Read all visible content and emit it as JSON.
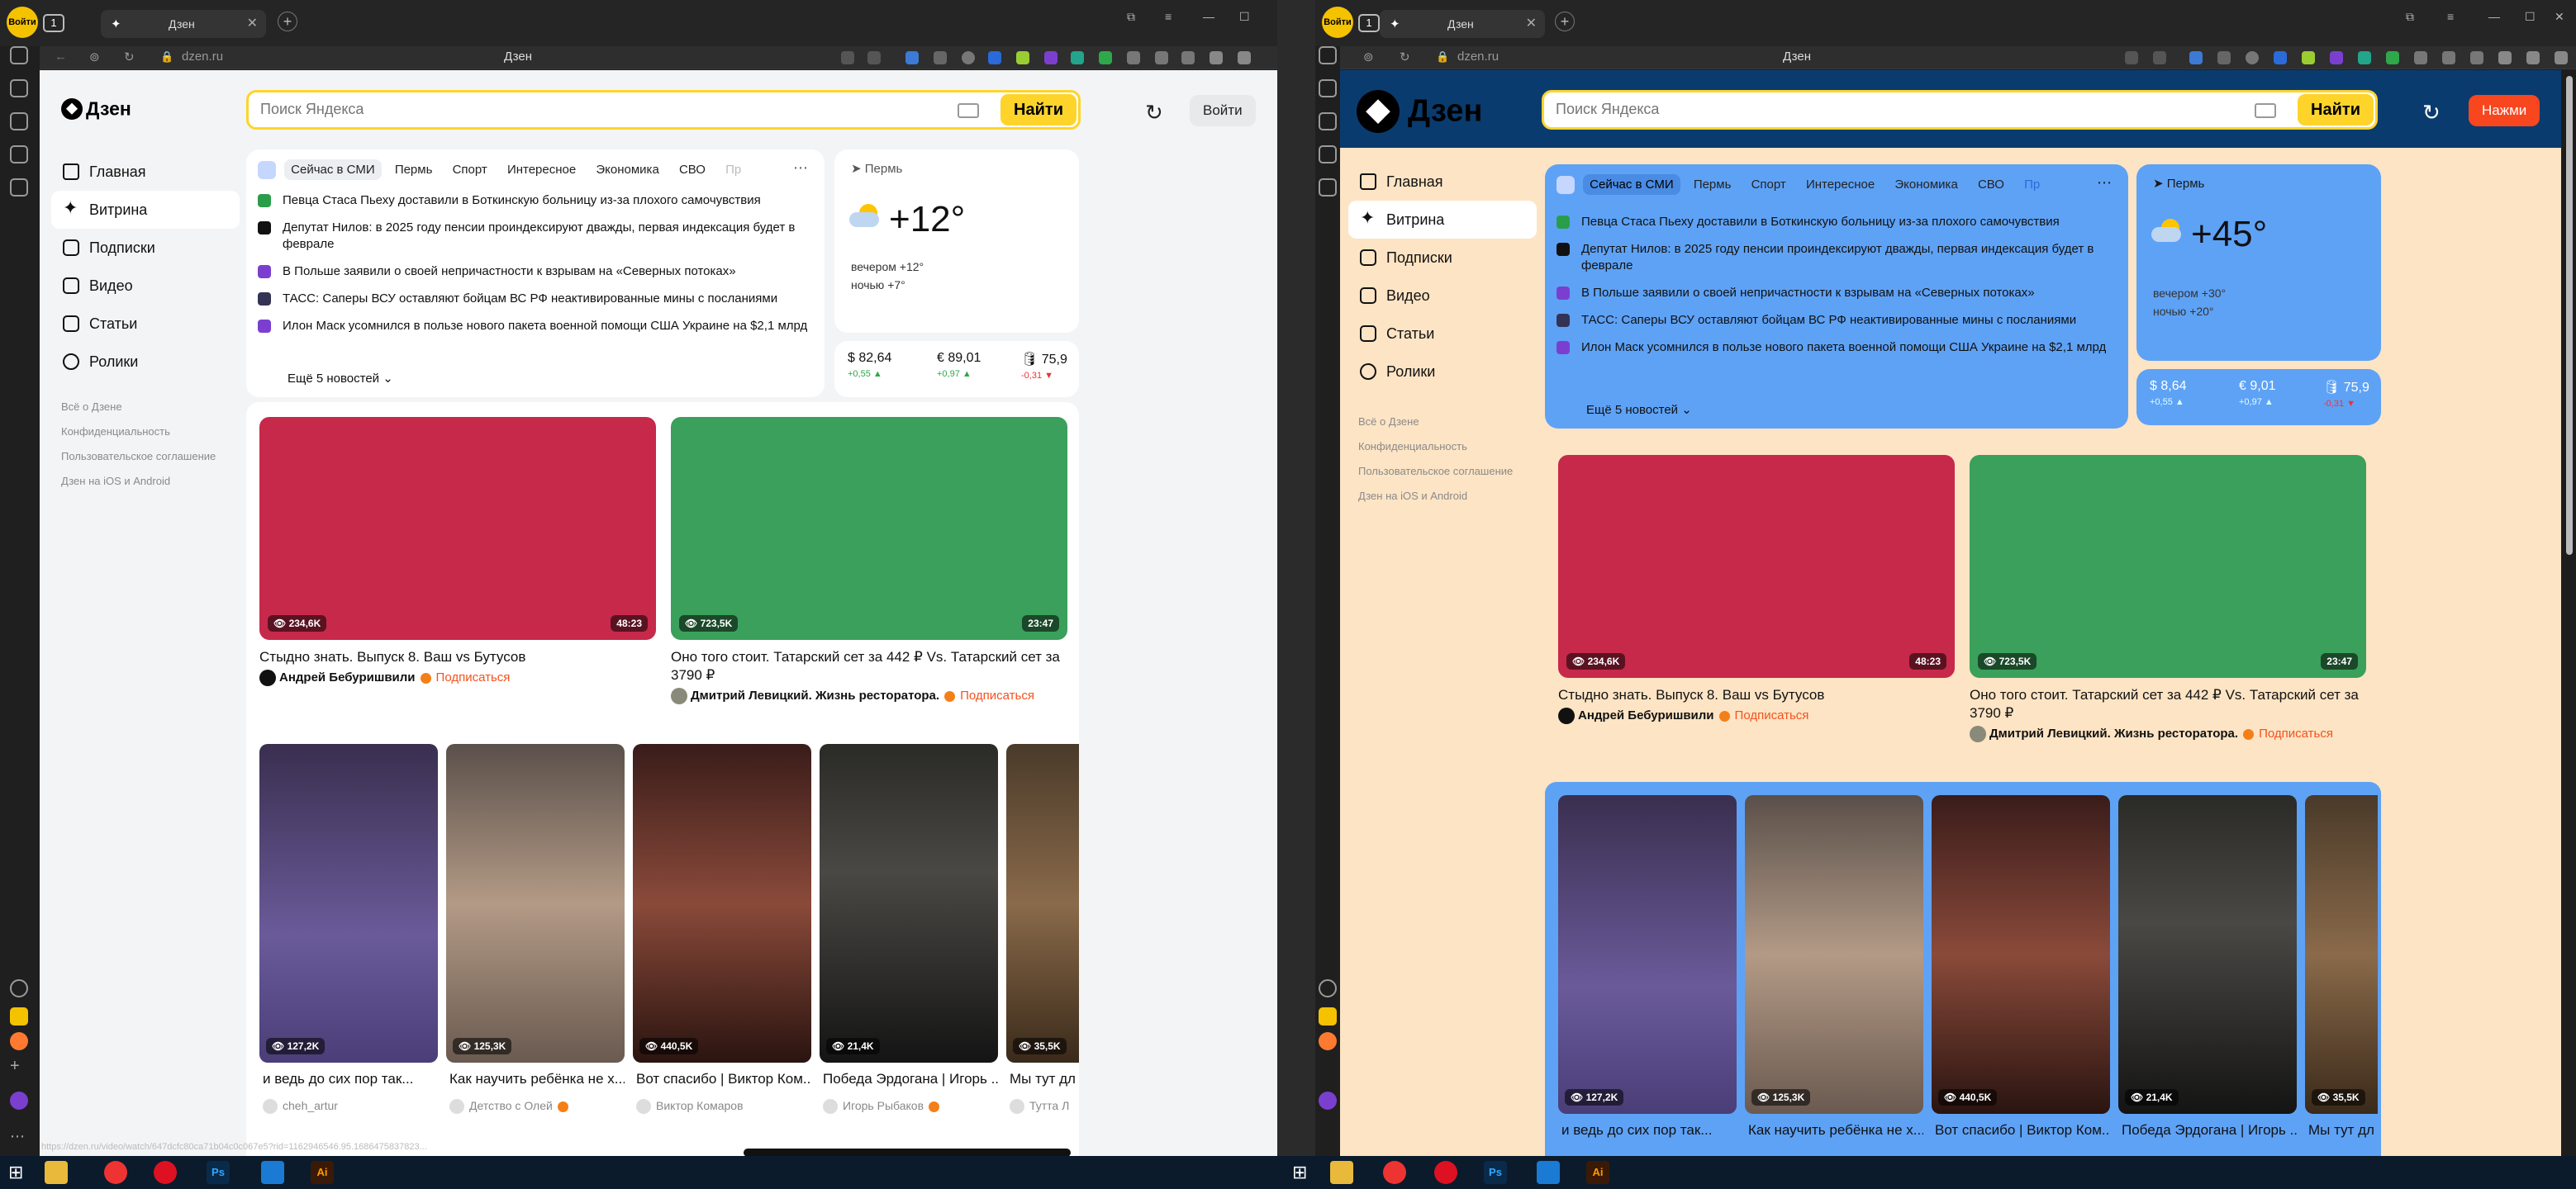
{
  "browser": {
    "yandex_badge": "Войти",
    "tab_count": "1",
    "tab_title": "Дзен",
    "url": "dzen.ru",
    "page_title": "Дзен",
    "status_url": "https://dzen.ru/video/watch/647dcfc80ca71b04c0c067e5?rid=1162946546.95.1686475837823..."
  },
  "header": {
    "logo": "Дзен",
    "search_placeholder": "Поиск Яндекса",
    "search_button": "Найти",
    "login_left": "Войти",
    "login_right": "Нажми"
  },
  "nav": {
    "items": [
      {
        "label": "Главная"
      },
      {
        "label": "Витрина"
      },
      {
        "label": "Подписки"
      },
      {
        "label": "Видео"
      },
      {
        "label": "Статьи"
      },
      {
        "label": "Ролики"
      }
    ],
    "footer": [
      "Всё о Дзене",
      "Конфиденциальность",
      "Пользовательское соглашение",
      "Дзен на iOS и Android"
    ]
  },
  "news": {
    "tabs": [
      "Сейчас в СМИ",
      "Пермь",
      "Спорт",
      "Интересное",
      "Экономика",
      "СВО",
      "Пр"
    ],
    "items": [
      "Певца Стаса Пьеху доставили в Боткинскую больницу из-за плохого самочувствия",
      "Депутат Нилов: в 2025 году пенсии проиндексируют дважды, первая индексация будет в феврале",
      "В Польше заявили о своей непричастности к взрывам на «Северных потоках»",
      "ТАСС: Саперы ВСУ оставляют бойцам ВС РФ неактивированные мины с посланиями",
      "Илон Маск усомнился в пользе нового пакета военной помощи США Украине на $2,1 млрд"
    ],
    "more": "Ещё 5 новостей"
  },
  "weather": {
    "city": "Пермь",
    "left": {
      "temp": "+12°",
      "evening": "вечером +12°",
      "night": "ночью +7°"
    },
    "right": {
      "temp": "+45°",
      "evening": "вечером +30°",
      "night": "ночью +20°"
    }
  },
  "rates": {
    "left": [
      {
        "value": "$ 82,64",
        "delta": "+0,55 ▲"
      },
      {
        "value": "€ 89,01",
        "delta": "+0,97 ▲"
      },
      {
        "value": "🛢 75,9",
        "delta": "-0,31 ▼"
      }
    ],
    "right": [
      {
        "value": "$ 8,64",
        "delta": "+0,55 ▲"
      },
      {
        "value": "€ 9,01",
        "delta": "+0,97 ▲"
      },
      {
        "value": "🛢 75,9",
        "delta": "-0,31 ▼"
      }
    ]
  },
  "videos": [
    {
      "views": "234,6K",
      "duration": "48:23",
      "title": "Стыдно знать. Выпуск 8. Ваш vs Бутусов",
      "author": "Андрей Бебуришвили",
      "subscribe": "Подписаться",
      "color": "#c7294a"
    },
    {
      "views": "723,5K",
      "duration": "23:47",
      "title": "Оно того стоит. Татарский сет за 442 ₽ Vs. Татарский сет за 3790 ₽",
      "author": "Дмитрий Левицкий. Жизнь ресторатора.",
      "subscribe": "Подписаться",
      "color": "#3aa05b"
    }
  ],
  "shorts": [
    {
      "views": "127,2K",
      "title": "и ведь до сих пор так...",
      "author": "cheh_artur"
    },
    {
      "views": "125,3K",
      "title": "Как научить ребёнка не х...",
      "author": "Детство с Олей"
    },
    {
      "views": "440,5K",
      "title": "Вот спасибо | Виктор Ком...",
      "author": "Виктор Комаров"
    },
    {
      "views": "21,4K",
      "title": "Победа Эрдогана | Игорь ...",
      "author": "Игорь Рыбаков"
    },
    {
      "views": "35,5K",
      "title": "Мы тут дл",
      "author": "Тутта Л"
    }
  ]
}
